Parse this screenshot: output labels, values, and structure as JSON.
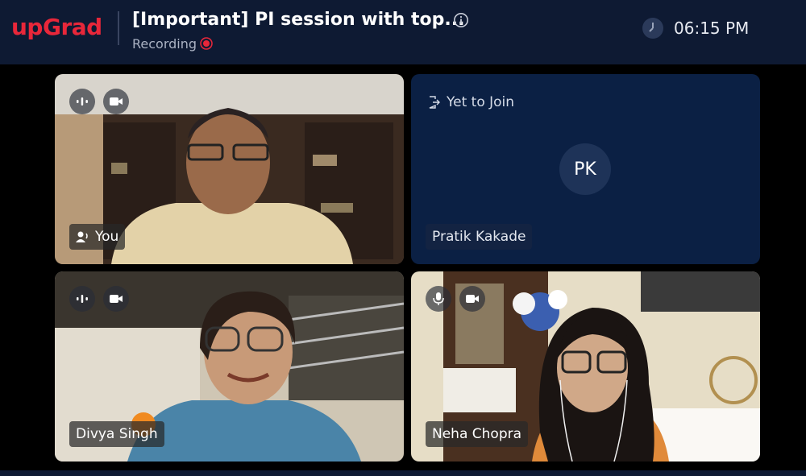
{
  "header": {
    "logo": "upGrad",
    "title": "[Important] PI session with top...",
    "status": "Recording",
    "time": "06:15 PM"
  },
  "tiles": [
    {
      "name": "You",
      "video": true,
      "mic_icon": "speaking-icon",
      "cam_icon": "camera-icon"
    },
    {
      "status": "Yet to Join",
      "initials": "PK",
      "name": "Pratik Kakade",
      "video": false
    },
    {
      "name": "Divya Singh",
      "video": true,
      "mic_icon": "speaking-icon",
      "cam_icon": "camera-icon"
    },
    {
      "name": "Neha Chopra",
      "video": true,
      "mic_icon": "microphone-icon",
      "cam_icon": "camera-icon"
    }
  ],
  "colors": {
    "brand": "#e8273a",
    "header_bg": "#0e1a33",
    "pending_tile_bg": "#0b2044",
    "recording_indicator": "#e8273a"
  }
}
